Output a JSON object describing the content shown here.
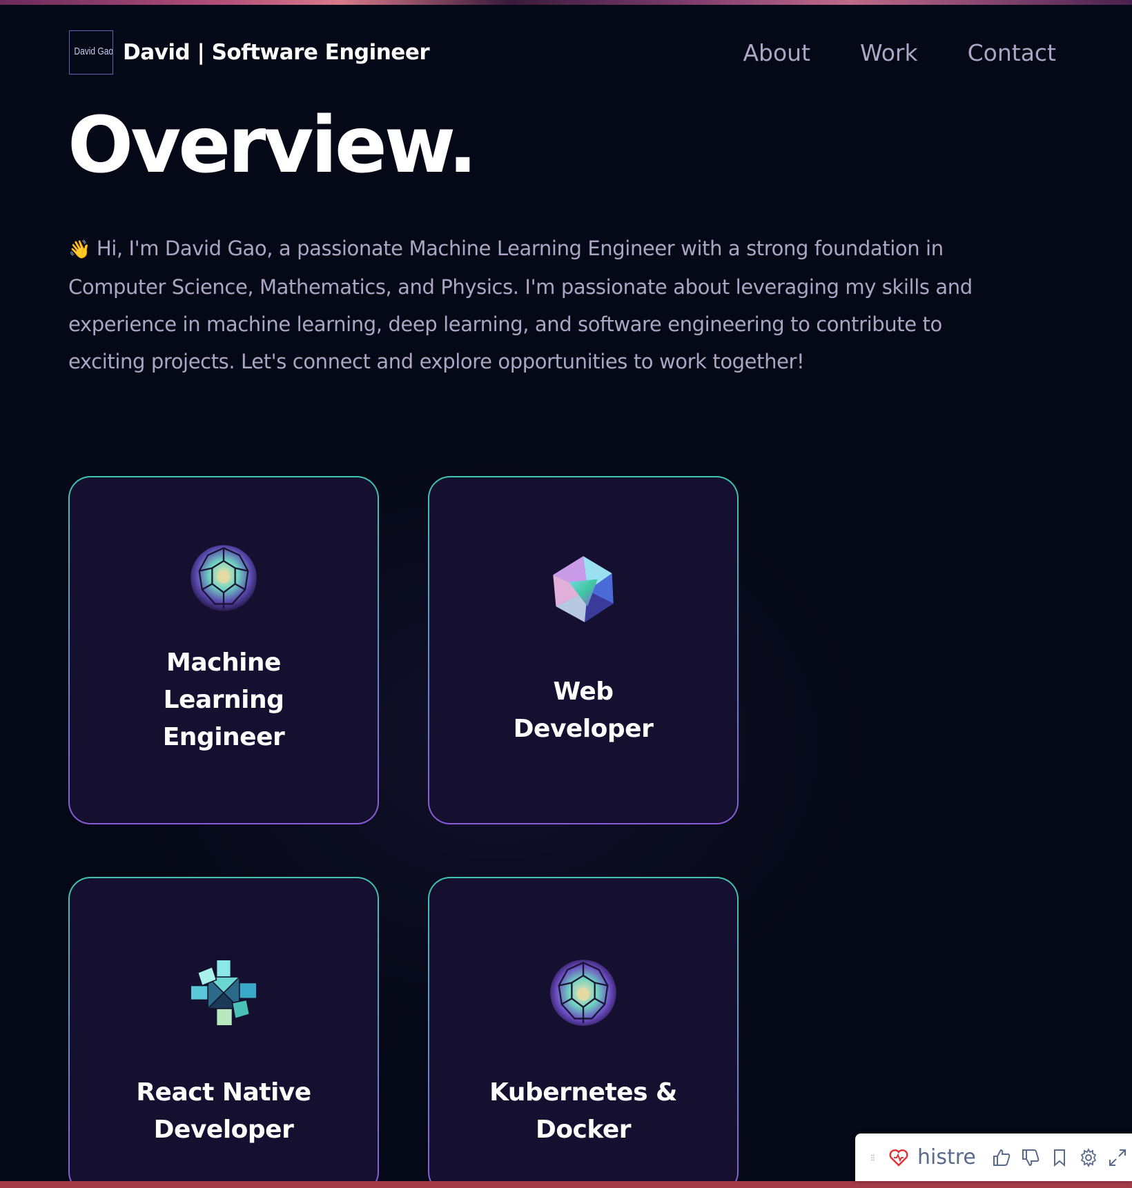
{
  "nav": {
    "logo_text": "David Gao",
    "brand_title": "David  | Software Engineer",
    "links": [
      "About",
      "Work",
      "Contact"
    ]
  },
  "overview": {
    "heading": "Overview.",
    "wave_emoji": "👋",
    "intro": "Hi, I'm David Gao, a passionate Machine Learning Engineer with a strong foundation in Computer Science, Mathematics, and Physics. I'm passionate about leveraging my skills and experience in machine learning, deep learning, and software engineering to contribute to exciting projects. Let's connect and explore opportunities to work together!"
  },
  "services": [
    {
      "title": "Machine Learning Engineer",
      "icon": "sphere-cluster-icon"
    },
    {
      "title": "Web Developer",
      "icon": "icosahedron-icon"
    },
    {
      "title": "React Native Developer",
      "icon": "cube-knot-icon"
    },
    {
      "title": "Kubernetes & Docker",
      "icon": "sphere-cluster-icon"
    }
  ],
  "histre": {
    "name": "histre",
    "icons": [
      "drag-handle-icon",
      "heart-icon",
      "thumbs-up-icon",
      "thumbs-down-icon",
      "bookmark-icon",
      "gear-icon",
      "expand-icon"
    ]
  },
  "colors": {
    "background": "#050816",
    "card": "#151030",
    "border_top": "#3fc7b0",
    "border_bottom": "#8a5ad8",
    "secondary_text": "#aaa6c3"
  }
}
